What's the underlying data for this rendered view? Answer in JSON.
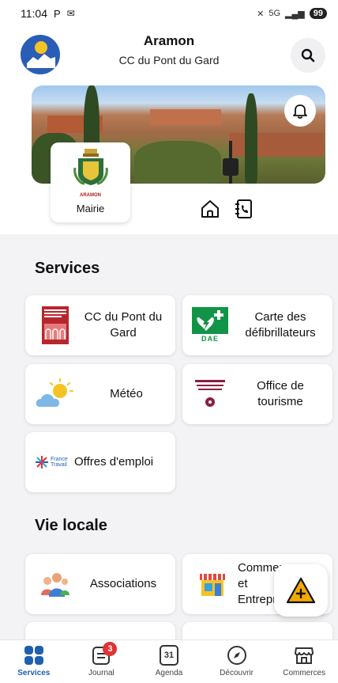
{
  "status_bar": {
    "time": "11:04",
    "battery": "99"
  },
  "header": {
    "title": "Aramon",
    "subtitle": "CC du Pont du Gard"
  },
  "mairie": {
    "label": "Mairie",
    "crest_text": "ARAMON"
  },
  "sections": {
    "services": {
      "title": "Services",
      "items": [
        {
          "label": "CC du Pont du Gard",
          "icon": "cc-pont-du-gard-logo-icon"
        },
        {
          "label": "Carte des défibrillateurs",
          "icon": "dae-defibrillator-icon",
          "badge_text": "DAE"
        },
        {
          "label": "Météo",
          "icon": "weather-sun-cloud-icon"
        },
        {
          "label": "Office de tourisme",
          "icon": "tourism-office-logo-icon"
        },
        {
          "label": "Offres d'emploi",
          "icon": "france-travail-logo-icon",
          "logo_text": "France Travail"
        }
      ]
    },
    "vie_locale": {
      "title": "Vie locale",
      "items": [
        {
          "label": "Associations",
          "icon": "associations-people-icon"
        },
        {
          "label": "Commerces et Entreprises",
          "icon": "shop-icon"
        }
      ]
    }
  },
  "bottom_nav": [
    {
      "label": "Services",
      "icon": "grid-icon",
      "active": true
    },
    {
      "label": "Journal",
      "icon": "journal-icon",
      "badge": "3"
    },
    {
      "label": "Agenda",
      "icon": "calendar-icon",
      "day": "31"
    },
    {
      "label": "Découvrir",
      "icon": "compass-icon"
    },
    {
      "label": "Commerces",
      "icon": "store-icon"
    }
  ],
  "colors": {
    "accent": "#1f5fb0",
    "badge": "#e03333",
    "fab_warning": "#f2a900"
  }
}
